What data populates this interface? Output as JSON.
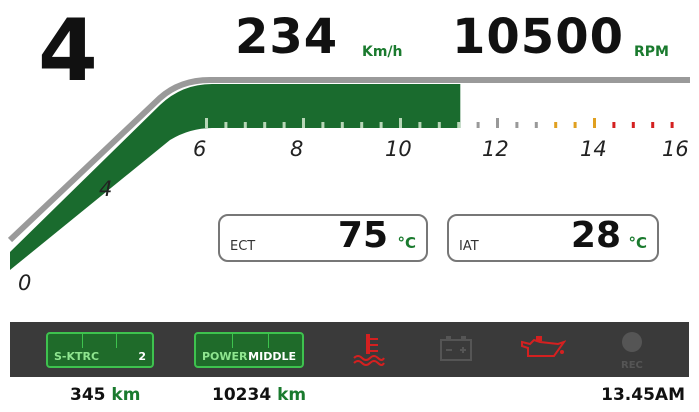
{
  "gear": "4",
  "speed": {
    "value": "234",
    "unit": "Km/h"
  },
  "rpm": {
    "value": "10500",
    "unit": "RPM",
    "level_fraction": 0.656
  },
  "tach": {
    "scale_labels": [
      "0",
      "4",
      "6",
      "8",
      "10",
      "12",
      "14",
      "16"
    ]
  },
  "ect": {
    "label": "ECT",
    "value": "75",
    "unit": "°C"
  },
  "iat": {
    "label": "IAT",
    "value": "28",
    "unit": "°C"
  },
  "status_bar": {
    "ktrc": {
      "label": "S-KTRC",
      "value": "2"
    },
    "power": {
      "label": "POWER",
      "value": "MIDDLE"
    },
    "indicators": [
      {
        "name": "coolant-temperature-icon",
        "color": "#d42020",
        "active": true
      },
      {
        "name": "battery-icon",
        "color": "#555555",
        "active": false
      },
      {
        "name": "oil-pressure-icon",
        "color": "#d42020",
        "active": true
      },
      {
        "name": "rec-icon",
        "label": "REC",
        "color": "#555555",
        "active": false
      }
    ]
  },
  "odometers": [
    {
      "value": "345",
      "unit": "km"
    },
    {
      "value": "10234",
      "unit": "km"
    }
  ],
  "clock": "13.45AM",
  "colors": {
    "accent": "#1a6b2e",
    "warning": "#d42020",
    "caution": "#e0a020"
  }
}
